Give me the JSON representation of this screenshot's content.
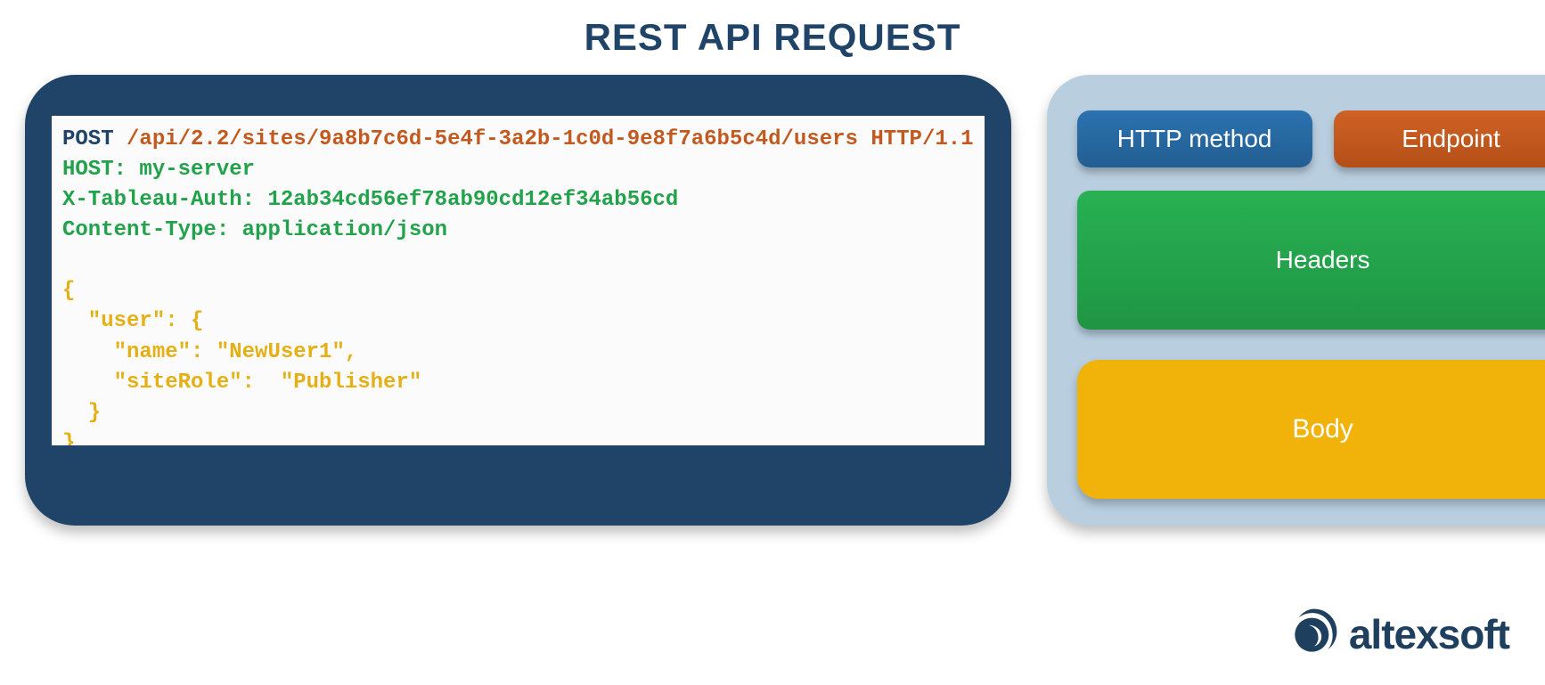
{
  "title": "REST API REQUEST",
  "code": {
    "line1_method": "POST",
    "line1_endpoint": " /api/2.2/sites/9a8b7c6d-5e4f-3a2b-1c0d-9e8f7a6b5c4d/users HTTP/1.1",
    "headers": "HOST: my-server\nX-Tableau-Auth: 12ab34cd56ef78ab90cd12ef34ab56cd\nContent-Type: application/json",
    "body": "{\n  \"user\": {\n    \"name\": \"NewUser1\",\n    \"siteRole\":  \"Publisher\"\n  }\n}"
  },
  "legend": {
    "method": "HTTP method",
    "endpoint": "Endpoint",
    "headers": "Headers",
    "body": "Body"
  },
  "brand": "altexsoft",
  "colors": {
    "method": "#256ba6",
    "endpoint": "#c25a1f",
    "headers": "#23a34b",
    "body": "#f1b20a"
  }
}
